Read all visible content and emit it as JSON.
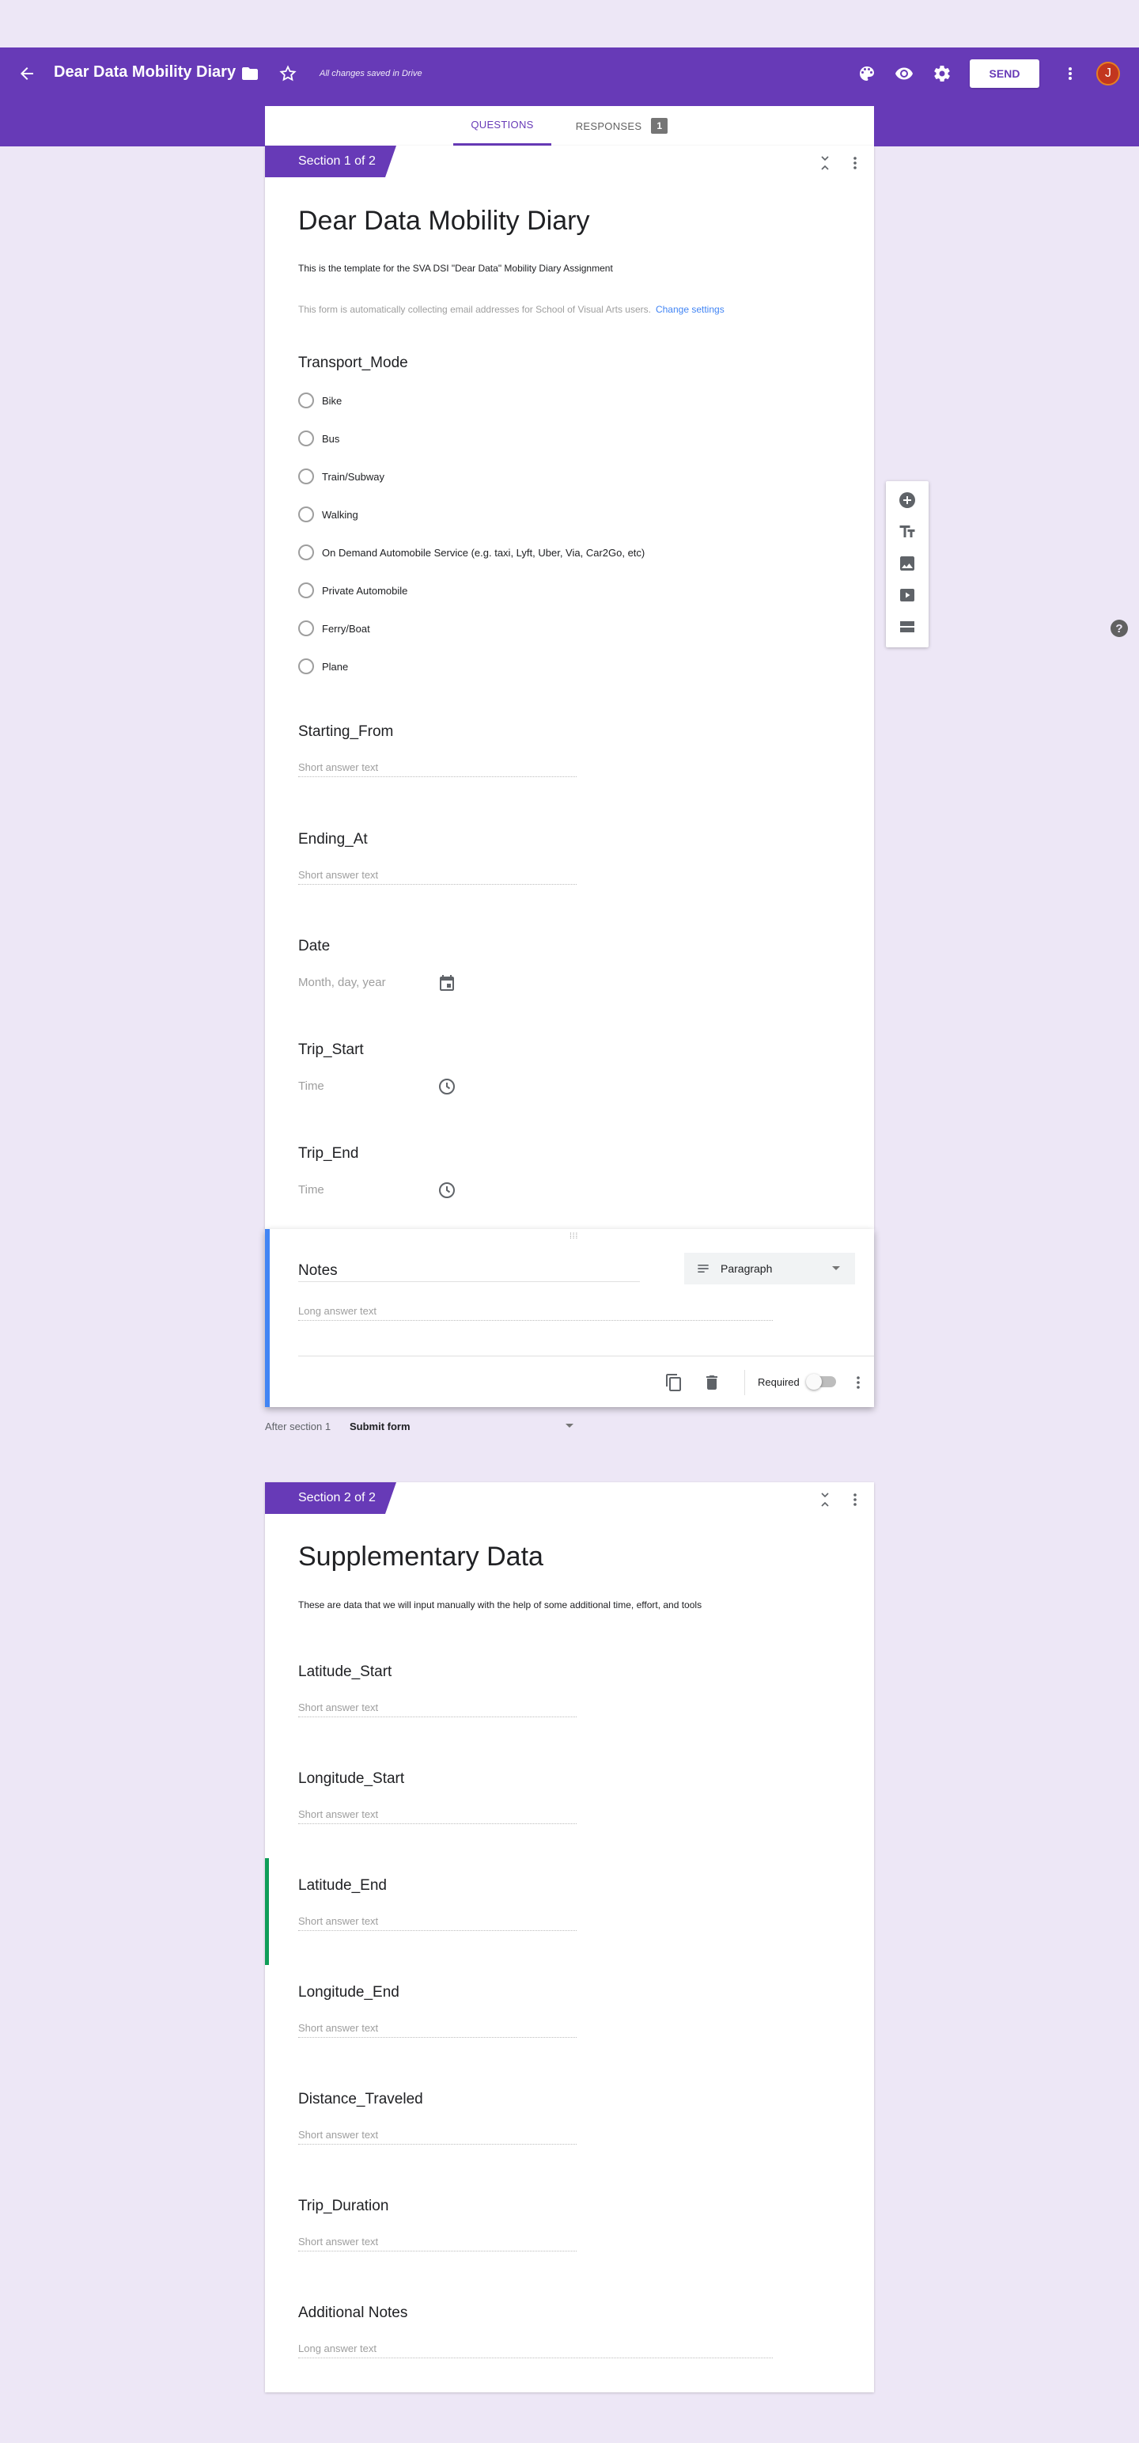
{
  "header": {
    "title": "Dear Data Mobility Diary",
    "saved_status": "All changes saved in Drive",
    "send_label": "SEND",
    "avatar_letter": "J",
    "icons": [
      "back-arrow-icon",
      "folder-icon",
      "star-icon",
      "palette-icon",
      "eye-icon",
      "gear-icon",
      "more-vert-icon"
    ]
  },
  "tabs": {
    "questions": "QUESTIONS",
    "responses": "RESPONSES",
    "responses_count": "1"
  },
  "section1": {
    "tag": "Section 1 of 2",
    "title": "Dear Data Mobility Diary",
    "description": "This is the template for the SVA DSI \"Dear Data\" Mobility Diary Assignment",
    "collecting_text": "This form is automatically collecting email addresses for School of Visual Arts users.",
    "change_settings": "Change settings",
    "transport": {
      "title": "Transport_Mode",
      "options": [
        "Bike",
        "Bus",
        "Train/Subway",
        "Walking",
        "On Demand Automobile Service (e.g. taxi, Lyft, Uber, Via, Car2Go, etc)",
        "Private Automobile",
        "Ferry/Boat",
        "Plane"
      ]
    },
    "starting_from": {
      "title": "Starting_From",
      "placeholder": "Short answer text"
    },
    "ending_at": {
      "title": "Ending_At",
      "placeholder": "Short answer text"
    },
    "date": {
      "title": "Date",
      "placeholder": "Month, day, year"
    },
    "trip_start": {
      "title": "Trip_Start",
      "placeholder": "Time"
    },
    "trip_end": {
      "title": "Trip_End",
      "placeholder": "Time"
    },
    "notes": {
      "title": "Notes",
      "type": "Paragraph",
      "placeholder": "Long answer text",
      "required_label": "Required"
    },
    "after_label": "After section 1",
    "after_value": "Submit form"
  },
  "section2": {
    "tag": "Section 2 of 2",
    "title": "Supplementary Data",
    "description": "These are data that we will input manually with the help of some additional time, effort, and tools",
    "questions": [
      {
        "title": "Latitude_Start",
        "placeholder": "Short answer text"
      },
      {
        "title": "Longitude_Start",
        "placeholder": "Short answer text"
      },
      {
        "title": "Latitude_End",
        "placeholder": "Short answer text"
      },
      {
        "title": "Longitude_End",
        "placeholder": "Short answer text"
      },
      {
        "title": "Distance_Traveled",
        "placeholder": "Short answer text"
      },
      {
        "title": "Trip_Duration",
        "placeholder": "Short answer text"
      },
      {
        "title": "Additional Notes",
        "placeholder": "Long answer text"
      }
    ]
  },
  "colors": {
    "brand": "#673ab7",
    "background": "#ede7f6",
    "active_border": "#4285f4",
    "section2_marker": "#0f9d58"
  }
}
